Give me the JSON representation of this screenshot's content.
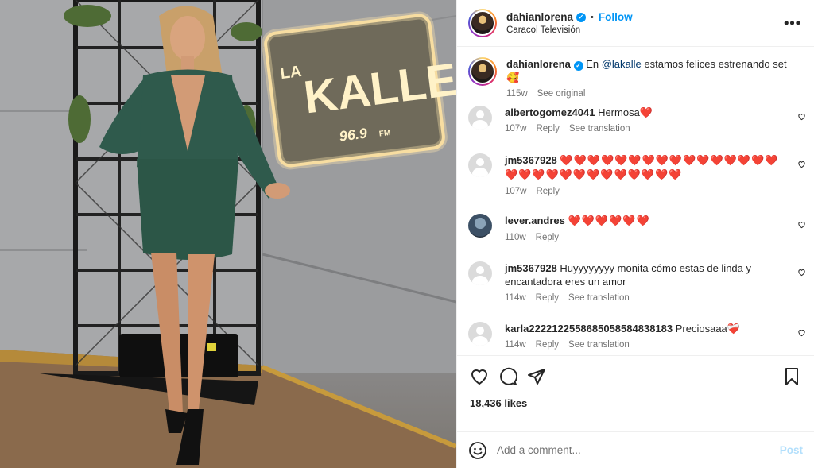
{
  "header": {
    "username": "dahianlorena",
    "follow_label": "Follow",
    "subtitle": "Caracol Televisión",
    "more_label": "•••"
  },
  "caption": {
    "username": "dahianlorena",
    "text_before": "En",
    "mention": "@lakalle",
    "text_after": "estamos felices estrenando set🥰",
    "time": "115w",
    "see_original": "See original"
  },
  "comments": [
    {
      "username": "albertogomez4041",
      "text": "Hermosa❤️",
      "time": "107w",
      "reply": "Reply",
      "translate": "See translation"
    },
    {
      "username": "jm5367928",
      "text": "❤️❤️❤️❤️❤️❤️❤️❤️❤️❤️❤️❤️❤️❤️❤️❤️❤️❤️❤️❤️❤️❤️❤️❤️❤️❤️❤️❤️❤️",
      "time": "107w",
      "reply": "Reply"
    },
    {
      "username": "lever.andres",
      "text": "❤️❤️❤️❤️❤️❤️",
      "time": "110w",
      "reply": "Reply"
    },
    {
      "username": "jm5367928",
      "text": "Huyyyyyyyy monita cómo estas de linda y encantadora eres un amor",
      "time": "114w",
      "reply": "Reply",
      "translate": "See translation"
    },
    {
      "username": "karla2222122558685058584838183",
      "text": "Preciosaaa❤️‍🩹",
      "time": "114w",
      "reply": "Reply",
      "translate": "See translation"
    }
  ],
  "post": {
    "likes": "18,436 likes",
    "add_comment_placeholder": "Add a comment...",
    "post_label": "Post"
  },
  "photo": {
    "sign_text": "KALLE",
    "sign_prefix": "LA",
    "sign_freq": "96.9",
    "sign_fm": "FM"
  },
  "colors": {
    "accent": "#0095f6",
    "heart": "#e02020",
    "text": "#262626",
    "muted": "#737373"
  }
}
